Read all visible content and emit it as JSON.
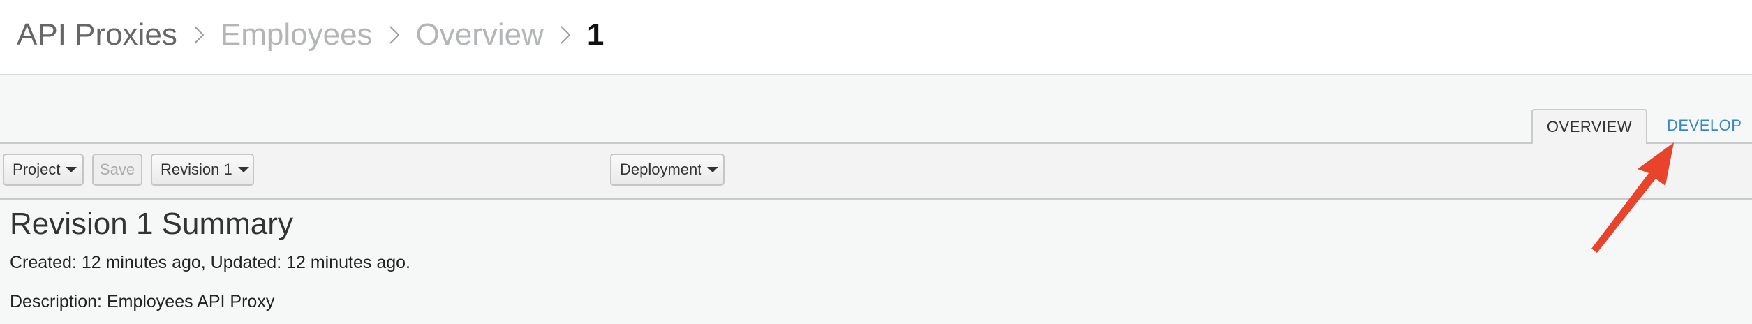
{
  "breadcrumb": {
    "items": [
      "API Proxies",
      "Employees",
      "Overview"
    ],
    "current": "1"
  },
  "tabs": {
    "overview": "OVERVIEW",
    "develop": "DEVELOP"
  },
  "toolbar": {
    "project": "Project",
    "save": "Save",
    "revision": "Revision 1",
    "deployment": "Deployment"
  },
  "summary": {
    "title": "Revision 1 Summary",
    "created": "Created: 12 minutes ago, Updated: 12 minutes ago.",
    "description": "Description: Employees API Proxy"
  },
  "colors": {
    "accent": "#3a87c7",
    "annotation_arrow": "#e8432b"
  },
  "icons": [
    "chevron-right-icon",
    "caret-down-icon",
    "annotation-arrow-icon"
  ]
}
